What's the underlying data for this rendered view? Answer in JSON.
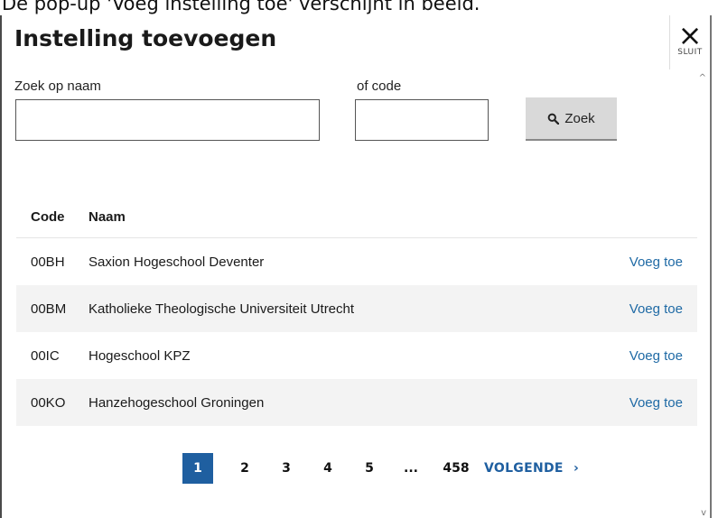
{
  "caption": "De pop-up 'Voeg instelling toe' verschijnt in beeld.",
  "modal": {
    "title": "Instelling toevoegen",
    "close_label": "SLUIT",
    "close_symbol": "×"
  },
  "search": {
    "name_label": "Zoek op naam",
    "code_label": "of code",
    "name_value": "",
    "code_value": "",
    "button_label": "Zoek"
  },
  "table": {
    "headers": {
      "code": "Code",
      "name": "Naam"
    },
    "rows": [
      {
        "code": "00BH",
        "name": "Saxion Hogeschool Deventer",
        "action": "Voeg toe"
      },
      {
        "code": "00BM",
        "name": "Katholieke Theologische Universiteit Utrecht",
        "action": "Voeg toe"
      },
      {
        "code": "00IC",
        "name": "Hogeschool KPZ",
        "action": "Voeg toe"
      },
      {
        "code": "00KO",
        "name": "Hanzehogeschool Groningen",
        "action": "Voeg toe"
      }
    ]
  },
  "pagination": {
    "pages": [
      "1",
      "2",
      "3",
      "4",
      "5",
      "...",
      "458"
    ],
    "current": "1",
    "next_label": "VOLGENDE",
    "next_symbol": "›"
  },
  "colors": {
    "accent": "#1f5fa0",
    "link": "#1f6aa5",
    "row_alt": "#f3f3f3"
  }
}
